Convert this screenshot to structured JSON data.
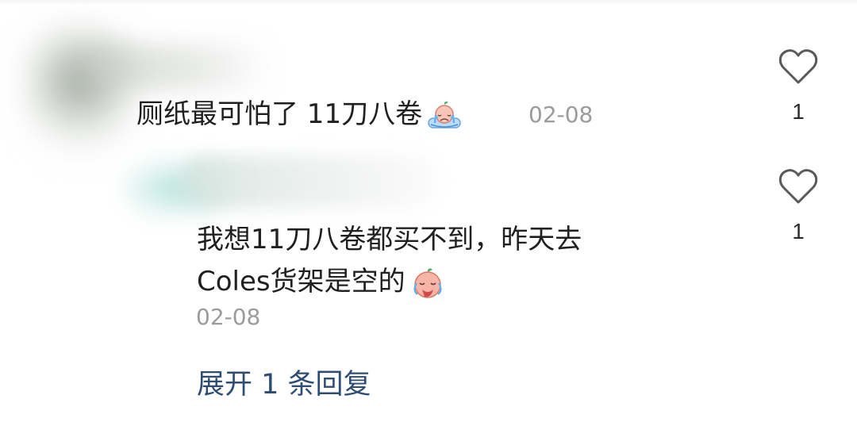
{
  "comments": [
    {
      "text": "厕纸最可怕了 11刀八卷",
      "emoji_icon": "crying-pillow-emoji-icon",
      "date": "02-08",
      "likes": "1"
    }
  ],
  "reply": {
    "line1": "我想11刀八卷都买不到，昨天去",
    "line2": "Coles货架是空的",
    "emoji_icon": "crying-face-emoji-icon",
    "date": "02-08",
    "likes": "1"
  },
  "expand_replies_label": "展开 1 条回复",
  "icons": {
    "like": "heart-outline-icon"
  },
  "colors": {
    "background": "#ffffff",
    "text": "#202020",
    "muted": "#9b9b9b",
    "link": "#2f4d73"
  }
}
